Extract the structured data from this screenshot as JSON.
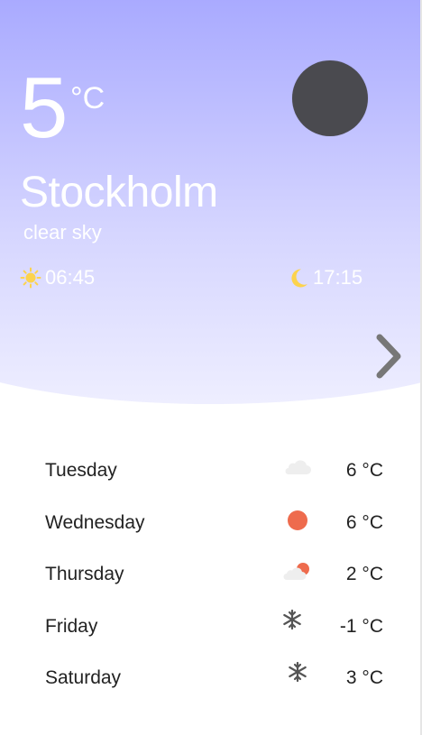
{
  "current": {
    "temperature": "5",
    "unit": "°C",
    "city": "Stockholm",
    "description": "clear sky",
    "sunrise": "06:45",
    "sunset": "17:15",
    "icon": "dark-circle-icon",
    "sunrise_icon": "sun-icon",
    "sunset_icon": "moon-icon",
    "accent_color": "#fcd34d"
  },
  "forecast": [
    {
      "day": "Tuesday",
      "temp": "6 °C",
      "icon": "cloud-icon"
    },
    {
      "day": "Wednesday",
      "temp": "6 °C",
      "icon": "sun-icon"
    },
    {
      "day": "Thursday",
      "temp": "2 °C",
      "icon": "partly-cloudy-icon"
    },
    {
      "day": "Friday",
      "temp": "-1 °C",
      "icon": "snowflake-icon"
    },
    {
      "day": "Saturday",
      "temp": "3 °C",
      "icon": "snowflake-icon"
    }
  ],
  "navigation": {
    "next_icon": "chevron-right-icon"
  }
}
